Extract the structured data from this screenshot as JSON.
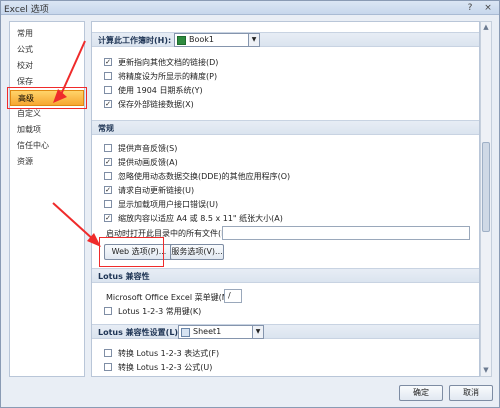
{
  "window": {
    "title": "Excel 选项",
    "help_icon": "?",
    "close_icon": "×"
  },
  "nav": {
    "items": [
      {
        "label": "常用"
      },
      {
        "label": "公式"
      },
      {
        "label": "校对"
      },
      {
        "label": "保存"
      },
      {
        "label": "高级",
        "selected": true
      },
      {
        "label": "自定义"
      },
      {
        "label": "加载项"
      },
      {
        "label": "信任中心"
      },
      {
        "label": "资源"
      }
    ]
  },
  "workbook_calc": {
    "heading": "计算此工作簿时(H):",
    "workbook_value": "Book1",
    "options": [
      {
        "label": "更新指向其他文档的链接(D)",
        "checked": true
      },
      {
        "label": "将精度设为所显示的精度(P)",
        "checked": false
      },
      {
        "label": "使用 1904 日期系统(Y)",
        "checked": false
      },
      {
        "label": "保存外部链接数据(X)",
        "checked": true
      }
    ]
  },
  "general": {
    "heading": "常规",
    "options": [
      {
        "label": "提供声音反馈(S)",
        "checked": false
      },
      {
        "label": "提供动画反馈(A)",
        "checked": true
      },
      {
        "label": "忽略使用动态数据交换(DDE)的其他应用程序(O)",
        "checked": false
      },
      {
        "label": "请求自动更新链接(U)",
        "checked": true
      },
      {
        "label": "显示加载项用户接口错误(U)",
        "checked": false
      },
      {
        "label": "缩放内容以适应 A4 或 8.5 x 11\" 纸张大小(A)",
        "checked": true
      }
    ],
    "startup_label": "启动时打开此目录中的所有文件(L):",
    "startup_value": "",
    "web_options_button": "Web 选项(P)...",
    "service_options_button": "服务选项(V)..."
  },
  "lotus_compat": {
    "heading": "Lotus 兼容性",
    "menu_key_label": "Microsoft Office Excel 菜单键(M):",
    "menu_key_value": "/",
    "nav_keys_label": "Lotus 1-2-3 常用键(K)",
    "nav_keys_checked": false
  },
  "lotus_settings": {
    "heading": "Lotus 兼容性设置(L):",
    "sheet_value": "Sheet1",
    "options": [
      {
        "label": "转换 Lotus 1-2-3 表达式(F)",
        "checked": false
      },
      {
        "label": "转换 Lotus 1-2-3 公式(U)",
        "checked": false
      }
    ]
  },
  "footer": {
    "ok_button": "确定",
    "cancel_button": "取消"
  },
  "colors": {
    "highlight": "#f7a731",
    "annotation": "#ef2b2b"
  }
}
